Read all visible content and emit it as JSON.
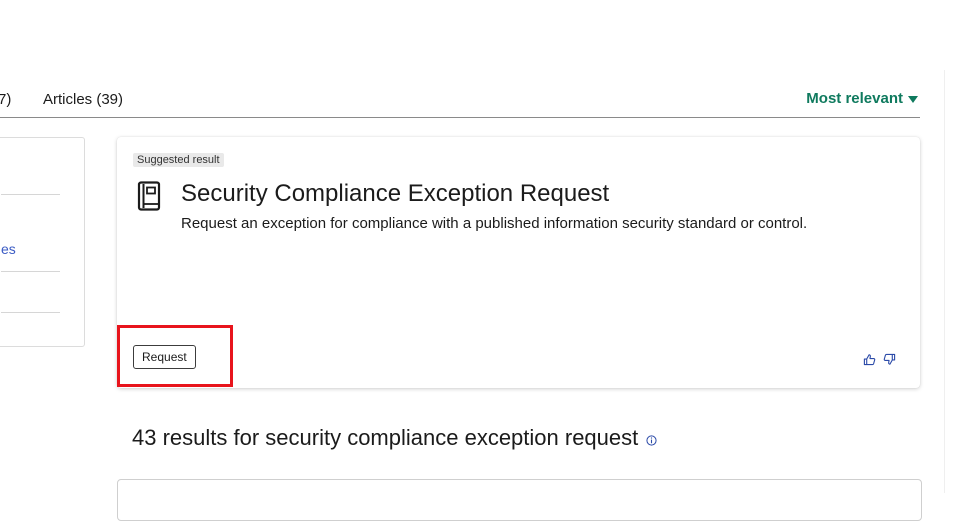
{
  "tabs": {
    "previous_tab_fragment": "7)",
    "articles_tab": "Articles (39)"
  },
  "sort": {
    "label": "Most relevant"
  },
  "filters": {
    "link_fragment": "es"
  },
  "suggested": {
    "badge": "Suggested result",
    "title": "Security Compliance Exception Request",
    "description": "Request an exception for compliance with a published information security standard or control.",
    "action_label": "Request",
    "icons": [
      "book-icon",
      "thumbs-up-icon",
      "thumbs-down-icon"
    ]
  },
  "results": {
    "heading": "43 results for security compliance exception request"
  },
  "colors": {
    "accent_green": "#0f7a5e",
    "link_blue": "#3b5bc4",
    "highlight_red": "#e8141c"
  }
}
